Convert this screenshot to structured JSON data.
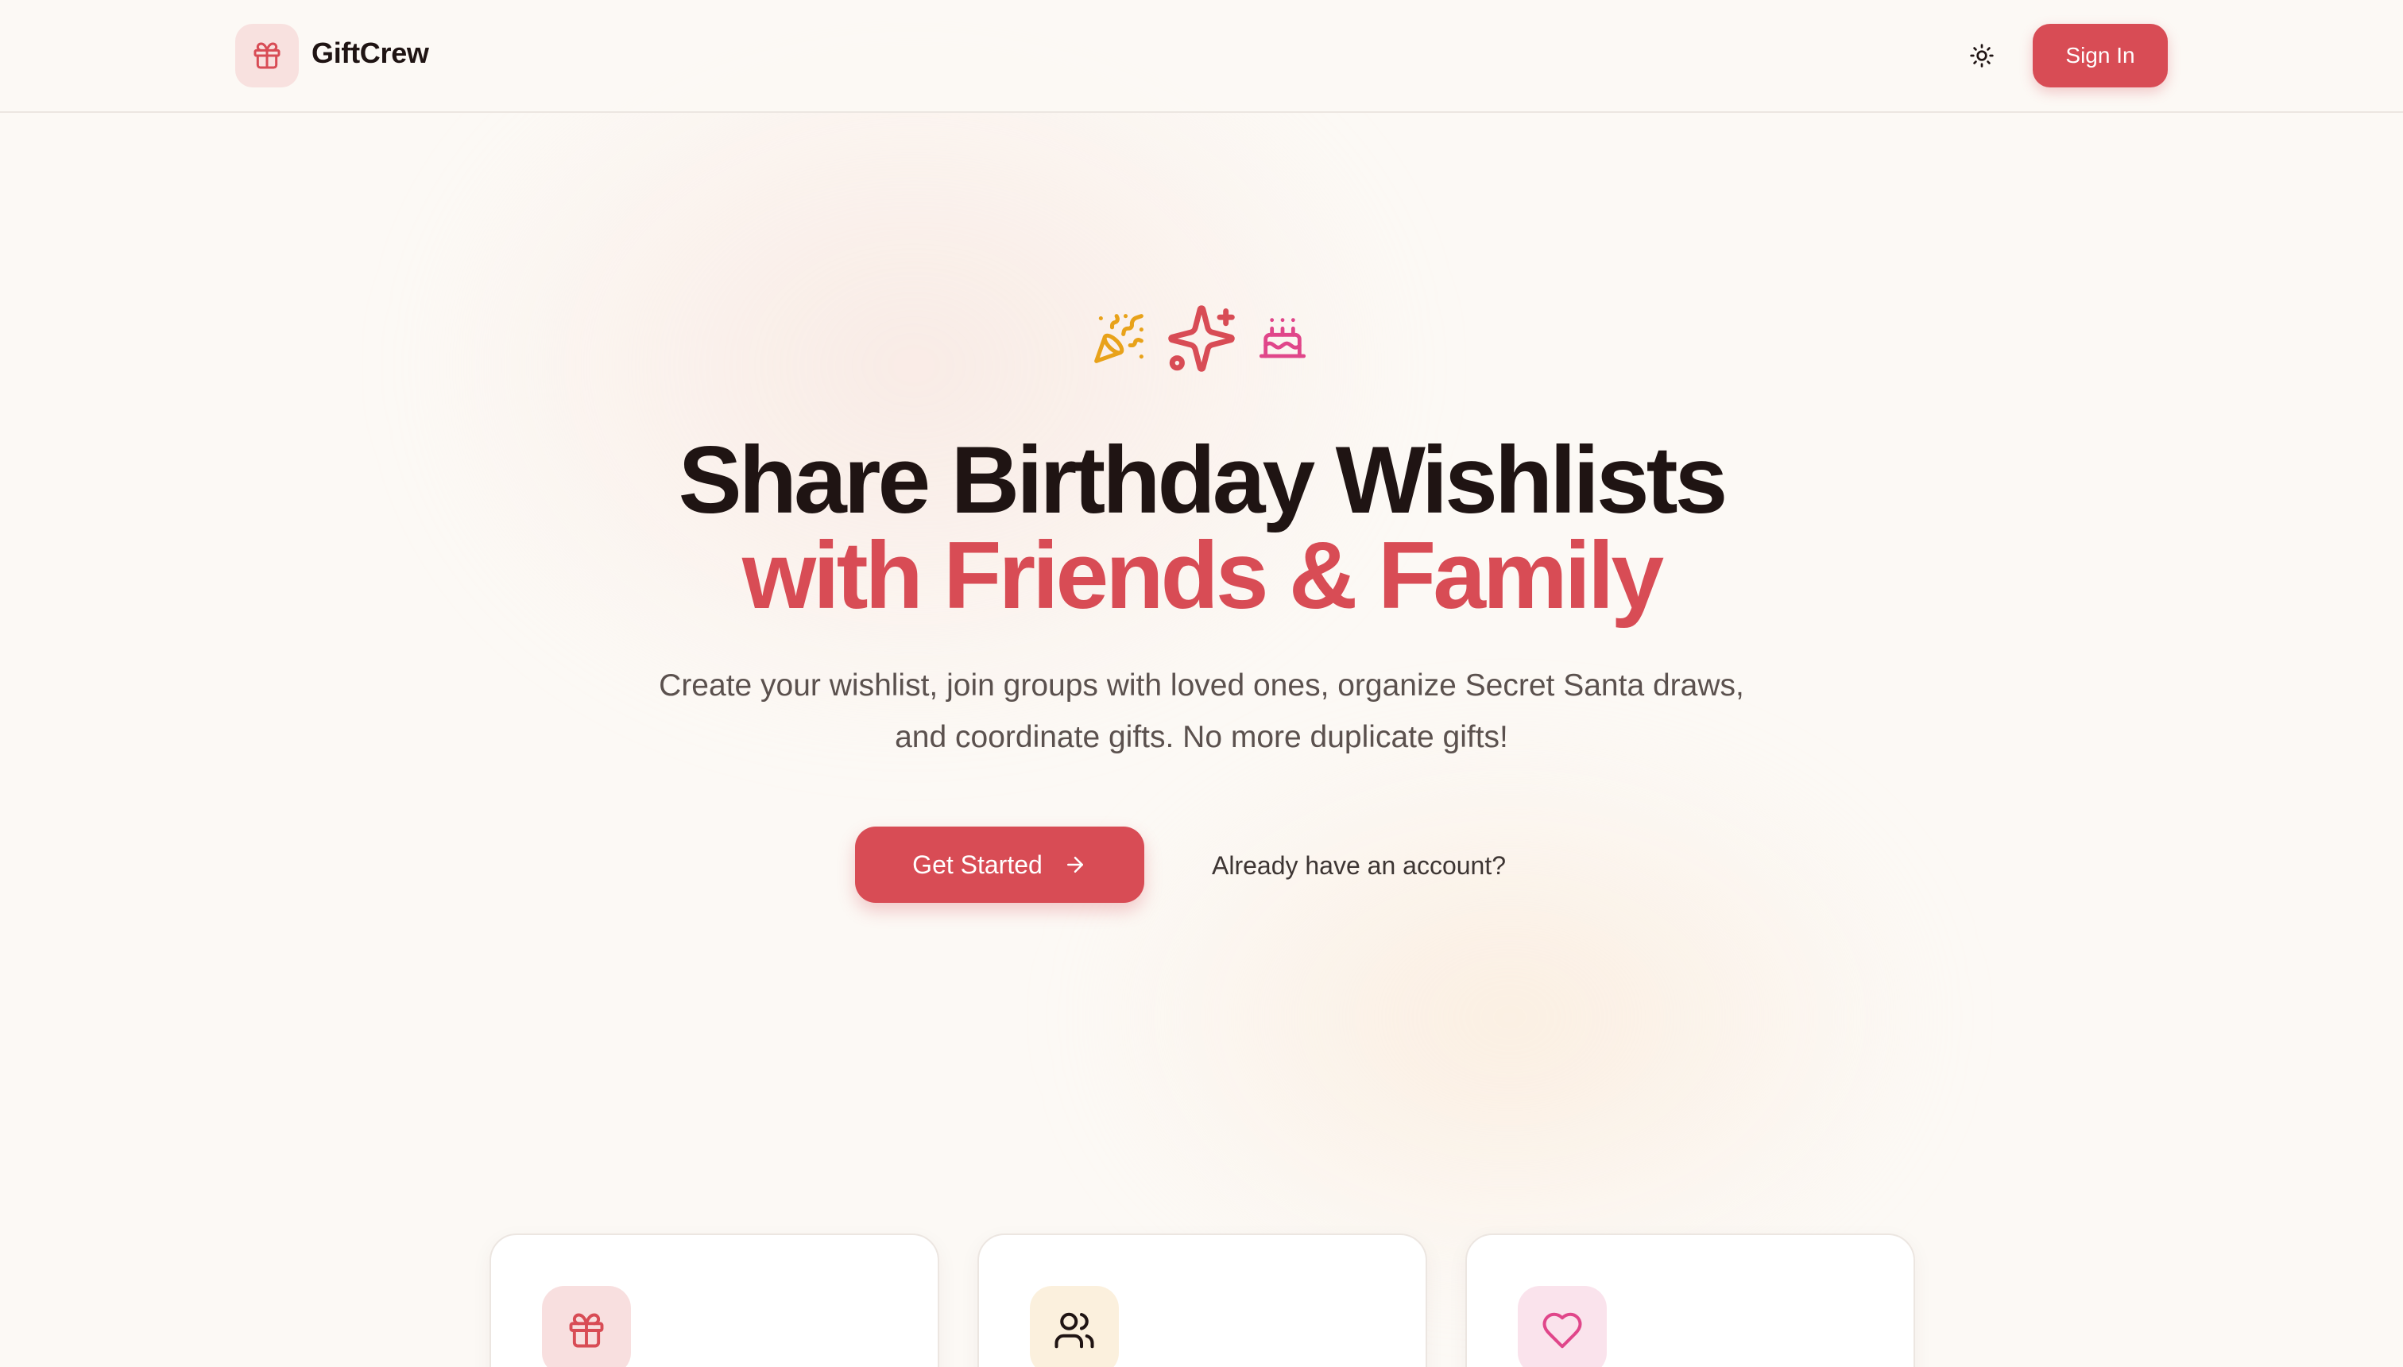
{
  "header": {
    "brand_name": "GiftCrew",
    "logo_icon": "gift-icon",
    "theme_toggle_icon": "sun-icon",
    "signin_label": "Sign In"
  },
  "hero": {
    "icons": [
      "party-popper-icon",
      "sparkles-icon",
      "cake-icon"
    ],
    "title_line1": "Share Birthday Wishlists",
    "title_line2": "with Friends & Family",
    "subtitle": "Create your wishlist, join groups with loved ones, organize Secret Santa draws, and coordinate gifts. No more duplicate gifts!",
    "primary_cta": "Get Started",
    "primary_cta_icon": "arrow-right-icon",
    "secondary_cta": "Already have an account?"
  },
  "features": [
    {
      "icon": "gift-icon"
    },
    {
      "icon": "users-icon"
    },
    {
      "icon": "heart-icon"
    }
  ],
  "colors": {
    "accent": "#d84c55",
    "background": "#fcf9f5",
    "text_primary": "#1f1413",
    "text_secondary": "#5b514e",
    "party_popper": "#e8a21a",
    "cake": "#e0468a"
  }
}
